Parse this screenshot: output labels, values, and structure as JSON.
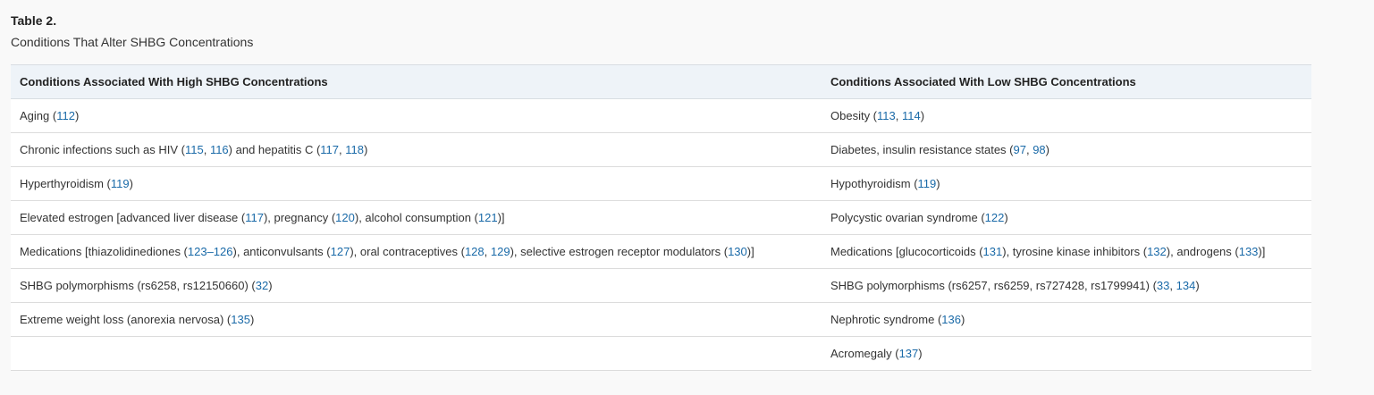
{
  "table": {
    "label": "Table 2.",
    "caption": "Conditions That Alter SHBG Concentrations",
    "headers": [
      "Conditions Associated With High SHBG Concentrations",
      "Conditions Associated With Low SHBG Concentrations"
    ],
    "rows": [
      [
        [
          {
            "t": "Aging ("
          },
          {
            "t": "112",
            "ref": true
          },
          {
            "t": ")"
          }
        ],
        [
          {
            "t": "Obesity ("
          },
          {
            "t": "113",
            "ref": true
          },
          {
            "t": ", "
          },
          {
            "t": "114",
            "ref": true
          },
          {
            "t": ")"
          }
        ]
      ],
      [
        [
          {
            "t": "Chronic infections such as HIV ("
          },
          {
            "t": "115",
            "ref": true
          },
          {
            "t": ", "
          },
          {
            "t": "116",
            "ref": true
          },
          {
            "t": ") and hepatitis C ("
          },
          {
            "t": "117",
            "ref": true
          },
          {
            "t": ", "
          },
          {
            "t": "118",
            "ref": true
          },
          {
            "t": ")"
          }
        ],
        [
          {
            "t": "Diabetes, insulin resistance states ("
          },
          {
            "t": "97",
            "ref": true
          },
          {
            "t": ", "
          },
          {
            "t": "98",
            "ref": true
          },
          {
            "t": ")"
          }
        ]
      ],
      [
        [
          {
            "t": "Hyperthyroidism ("
          },
          {
            "t": "119",
            "ref": true
          },
          {
            "t": ")"
          }
        ],
        [
          {
            "t": "Hypothyroidism ("
          },
          {
            "t": "119",
            "ref": true
          },
          {
            "t": ")"
          }
        ]
      ],
      [
        [
          {
            "t": "Elevated estrogen [advanced liver disease ("
          },
          {
            "t": "117",
            "ref": true
          },
          {
            "t": "), pregnancy ("
          },
          {
            "t": "120",
            "ref": true
          },
          {
            "t": "), alcohol consumption ("
          },
          {
            "t": "121",
            "ref": true
          },
          {
            "t": ")]"
          }
        ],
        [
          {
            "t": "Polycystic ovarian syndrome ("
          },
          {
            "t": "122",
            "ref": true
          },
          {
            "t": ")"
          }
        ]
      ],
      [
        [
          {
            "t": "Medications [thiazolidinediones ("
          },
          {
            "t": "123–126",
            "ref": true
          },
          {
            "t": "), anticonvulsants ("
          },
          {
            "t": "127",
            "ref": true
          },
          {
            "t": "), oral contraceptives ("
          },
          {
            "t": "128",
            "ref": true
          },
          {
            "t": ", "
          },
          {
            "t": "129",
            "ref": true
          },
          {
            "t": "), selective estrogen receptor modulators ("
          },
          {
            "t": "130",
            "ref": true
          },
          {
            "t": ")]"
          }
        ],
        [
          {
            "t": "Medications [glucocorticoids ("
          },
          {
            "t": "131",
            "ref": true
          },
          {
            "t": "), tyrosine kinase inhibitors ("
          },
          {
            "t": "132",
            "ref": true
          },
          {
            "t": "), androgens ("
          },
          {
            "t": "133",
            "ref": true
          },
          {
            "t": ")]"
          }
        ]
      ],
      [
        [
          {
            "t": "SHBG polymorphisms (rs6258, rs12150660) ("
          },
          {
            "t": "32",
            "ref": true
          },
          {
            "t": ")"
          }
        ],
        [
          {
            "t": "SHBG polymorphisms (rs6257, rs6259, rs727428, rs1799941) ("
          },
          {
            "t": "33",
            "ref": true
          },
          {
            "t": ", "
          },
          {
            "t": "134",
            "ref": true
          },
          {
            "t": ")"
          }
        ]
      ],
      [
        [
          {
            "t": "Extreme weight loss (anorexia nervosa) ("
          },
          {
            "t": "135",
            "ref": true
          },
          {
            "t": ")"
          }
        ],
        [
          {
            "t": "Nephrotic syndrome ("
          },
          {
            "t": "136",
            "ref": true
          },
          {
            "t": ")"
          }
        ]
      ],
      [
        [],
        [
          {
            "t": "Acromegaly ("
          },
          {
            "t": "137",
            "ref": true
          },
          {
            "t": ")"
          }
        ]
      ]
    ]
  }
}
